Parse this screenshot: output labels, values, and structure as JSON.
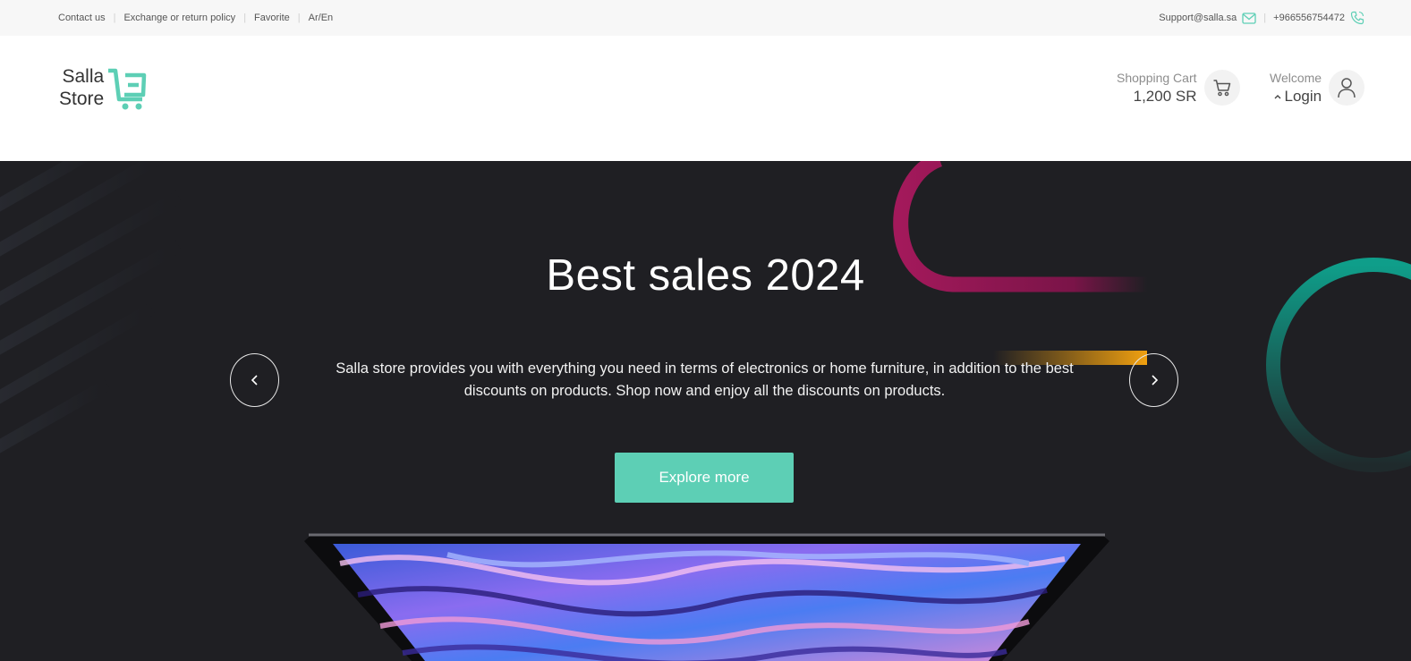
{
  "topbar": {
    "links": [
      "Contact us",
      "Exchange or return policy",
      "Favorite",
      "Ar/En"
    ],
    "email": "Support@salla.sa",
    "phone": "+966556754472"
  },
  "header": {
    "logo": {
      "line1": "Salla",
      "line2": "Store"
    },
    "cart": {
      "label": "Shopping Cart",
      "amount": "1,200 SR"
    },
    "user": {
      "label": "Welcome",
      "login": "Login"
    }
  },
  "hero": {
    "title": "Best sales 2024",
    "description": "Salla store provides you with everything you need in terms of electronics or home furniture, in addition to the best discounts on products. Shop now and enjoy all the discounts on products.",
    "cta": "Explore more"
  },
  "colors": {
    "accent": "#5dcfb5",
    "hero_background": "#1f1f23",
    "topbar_background": "#f7f7f7",
    "deco_pink": "#a3195b",
    "deco_teal": "#0f9e8a",
    "deco_orange": "#f0a010"
  },
  "icons": {
    "email": "mail-icon",
    "phone": "phone-icon",
    "cart": "cart-icon",
    "user": "user-icon",
    "login_chevron": "chevron-up-icon",
    "prev": "chevron-left-icon",
    "next": "chevron-right-icon"
  }
}
